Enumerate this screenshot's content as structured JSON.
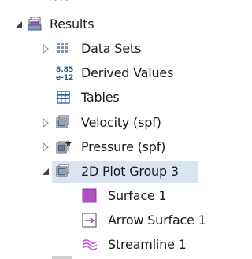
{
  "tree": {
    "results": {
      "label": "Results",
      "expanded": true,
      "icon": "results-folder-icon"
    },
    "data_sets": {
      "label": "Data Sets",
      "expanded": false,
      "icon": "data-sets-grid-icon"
    },
    "derived_values": {
      "label": "Derived Values",
      "icon_text_top": "8.85",
      "icon_text_bottom": "e-12",
      "icon": "derived-values-icon"
    },
    "tables": {
      "label": "Tables",
      "icon": "table-grid-icon"
    },
    "velocity": {
      "label": "Velocity (spf)",
      "expanded": false,
      "icon": "plot-group-icon"
    },
    "pressure": {
      "label": "Pressure (spf)",
      "expanded": false,
      "icon": "plot-group-star-icon"
    },
    "plot_group_3": {
      "label": "2D Plot Group 3",
      "expanded": true,
      "selected": true,
      "icon": "plot-group-icon"
    },
    "surface_1": {
      "label": "Surface 1",
      "icon": "surface-icon",
      "color": "#b14fc5"
    },
    "arrow_surface_1": {
      "label": "Arrow Surface 1",
      "icon": "arrow-surface-icon",
      "color": "#a23fb8"
    },
    "streamline_1": {
      "label": "Streamline 1",
      "icon": "streamline-icon",
      "color": "#c067d2"
    }
  },
  "colors": {
    "selection": "#d9e5f3",
    "text": "#1a1a1a",
    "expander": "#555555"
  }
}
